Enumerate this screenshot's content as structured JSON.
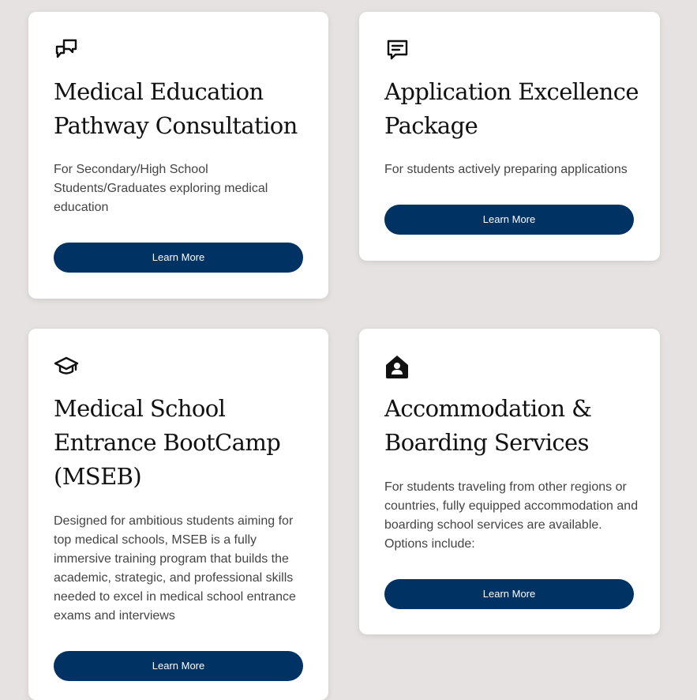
{
  "colors": {
    "background": "#e6e2e1",
    "card": "#ffffff",
    "button": "#003264",
    "button_text": "#ffffff",
    "title": "#111111",
    "body_text": "#444444"
  },
  "cards": [
    {
      "icon": "chat-bubbles-icon",
      "title": "Medical Education Pathway Consultation",
      "description": "For Secondary/High School Students/Graduates  exploring medical education",
      "button_label": "Learn More"
    },
    {
      "icon": "message-text-icon",
      "title": "Application Excellence Package",
      "description": "For students actively preparing applications",
      "button_label": "Learn More"
    },
    {
      "icon": "graduation-cap-icon",
      "title": "Medical School Entrance BootCamp (MSEB)",
      "description": "Designed for ambitious students aiming for top medical schools, MSEB is a fully immersive training program that builds the academic, strategic, and professional skills needed to excel in medical school entrance exams and interviews",
      "button_label": "Learn More"
    },
    {
      "icon": "home-user-icon",
      "title": "Accommodation & Boarding Services",
      "description": "For students traveling from other regions or countries, fully equipped accommodation and boarding school services are available. Options include:",
      "button_label": "Learn More"
    }
  ]
}
